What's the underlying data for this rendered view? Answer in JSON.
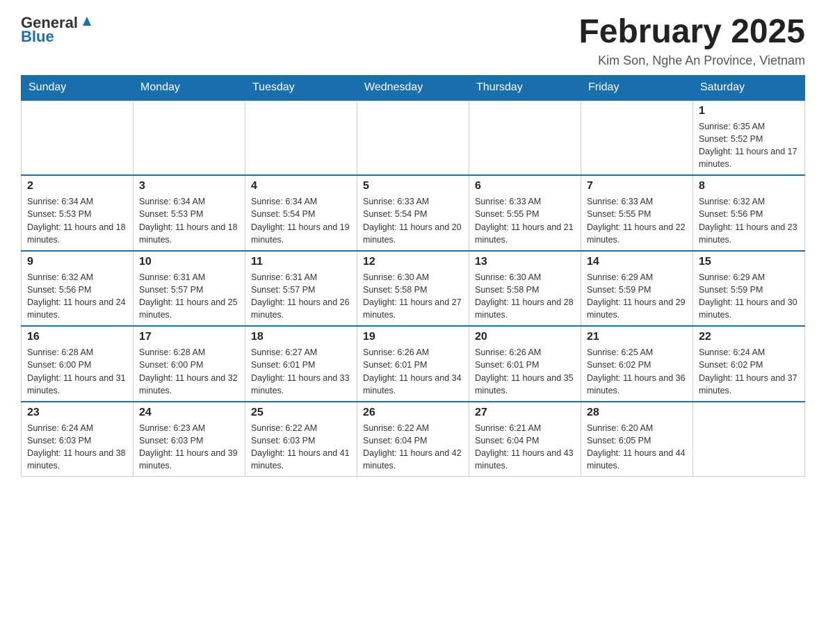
{
  "header": {
    "logo_general": "General",
    "logo_blue": "Blue",
    "month_title": "February 2025",
    "location": "Kim Son, Nghe An Province, Vietnam"
  },
  "days_of_week": [
    "Sunday",
    "Monday",
    "Tuesday",
    "Wednesday",
    "Thursday",
    "Friday",
    "Saturday"
  ],
  "weeks": [
    [
      {
        "day": "",
        "info": ""
      },
      {
        "day": "",
        "info": ""
      },
      {
        "day": "",
        "info": ""
      },
      {
        "day": "",
        "info": ""
      },
      {
        "day": "",
        "info": ""
      },
      {
        "day": "",
        "info": ""
      },
      {
        "day": "1",
        "info": "Sunrise: 6:35 AM\nSunset: 5:52 PM\nDaylight: 11 hours and 17 minutes."
      }
    ],
    [
      {
        "day": "2",
        "info": "Sunrise: 6:34 AM\nSunset: 5:53 PM\nDaylight: 11 hours and 18 minutes."
      },
      {
        "day": "3",
        "info": "Sunrise: 6:34 AM\nSunset: 5:53 PM\nDaylight: 11 hours and 18 minutes."
      },
      {
        "day": "4",
        "info": "Sunrise: 6:34 AM\nSunset: 5:54 PM\nDaylight: 11 hours and 19 minutes."
      },
      {
        "day": "5",
        "info": "Sunrise: 6:33 AM\nSunset: 5:54 PM\nDaylight: 11 hours and 20 minutes."
      },
      {
        "day": "6",
        "info": "Sunrise: 6:33 AM\nSunset: 5:55 PM\nDaylight: 11 hours and 21 minutes."
      },
      {
        "day": "7",
        "info": "Sunrise: 6:33 AM\nSunset: 5:55 PM\nDaylight: 11 hours and 22 minutes."
      },
      {
        "day": "8",
        "info": "Sunrise: 6:32 AM\nSunset: 5:56 PM\nDaylight: 11 hours and 23 minutes."
      }
    ],
    [
      {
        "day": "9",
        "info": "Sunrise: 6:32 AM\nSunset: 5:56 PM\nDaylight: 11 hours and 24 minutes."
      },
      {
        "day": "10",
        "info": "Sunrise: 6:31 AM\nSunset: 5:57 PM\nDaylight: 11 hours and 25 minutes."
      },
      {
        "day": "11",
        "info": "Sunrise: 6:31 AM\nSunset: 5:57 PM\nDaylight: 11 hours and 26 minutes."
      },
      {
        "day": "12",
        "info": "Sunrise: 6:30 AM\nSunset: 5:58 PM\nDaylight: 11 hours and 27 minutes."
      },
      {
        "day": "13",
        "info": "Sunrise: 6:30 AM\nSunset: 5:58 PM\nDaylight: 11 hours and 28 minutes."
      },
      {
        "day": "14",
        "info": "Sunrise: 6:29 AM\nSunset: 5:59 PM\nDaylight: 11 hours and 29 minutes."
      },
      {
        "day": "15",
        "info": "Sunrise: 6:29 AM\nSunset: 5:59 PM\nDaylight: 11 hours and 30 minutes."
      }
    ],
    [
      {
        "day": "16",
        "info": "Sunrise: 6:28 AM\nSunset: 6:00 PM\nDaylight: 11 hours and 31 minutes."
      },
      {
        "day": "17",
        "info": "Sunrise: 6:28 AM\nSunset: 6:00 PM\nDaylight: 11 hours and 32 minutes."
      },
      {
        "day": "18",
        "info": "Sunrise: 6:27 AM\nSunset: 6:01 PM\nDaylight: 11 hours and 33 minutes."
      },
      {
        "day": "19",
        "info": "Sunrise: 6:26 AM\nSunset: 6:01 PM\nDaylight: 11 hours and 34 minutes."
      },
      {
        "day": "20",
        "info": "Sunrise: 6:26 AM\nSunset: 6:01 PM\nDaylight: 11 hours and 35 minutes."
      },
      {
        "day": "21",
        "info": "Sunrise: 6:25 AM\nSunset: 6:02 PM\nDaylight: 11 hours and 36 minutes."
      },
      {
        "day": "22",
        "info": "Sunrise: 6:24 AM\nSunset: 6:02 PM\nDaylight: 11 hours and 37 minutes."
      }
    ],
    [
      {
        "day": "23",
        "info": "Sunrise: 6:24 AM\nSunset: 6:03 PM\nDaylight: 11 hours and 38 minutes."
      },
      {
        "day": "24",
        "info": "Sunrise: 6:23 AM\nSunset: 6:03 PM\nDaylight: 11 hours and 39 minutes."
      },
      {
        "day": "25",
        "info": "Sunrise: 6:22 AM\nSunset: 6:03 PM\nDaylight: 11 hours and 41 minutes."
      },
      {
        "day": "26",
        "info": "Sunrise: 6:22 AM\nSunset: 6:04 PM\nDaylight: 11 hours and 42 minutes."
      },
      {
        "day": "27",
        "info": "Sunrise: 6:21 AM\nSunset: 6:04 PM\nDaylight: 11 hours and 43 minutes."
      },
      {
        "day": "28",
        "info": "Sunrise: 6:20 AM\nSunset: 6:05 PM\nDaylight: 11 hours and 44 minutes."
      },
      {
        "day": "",
        "info": ""
      }
    ]
  ]
}
